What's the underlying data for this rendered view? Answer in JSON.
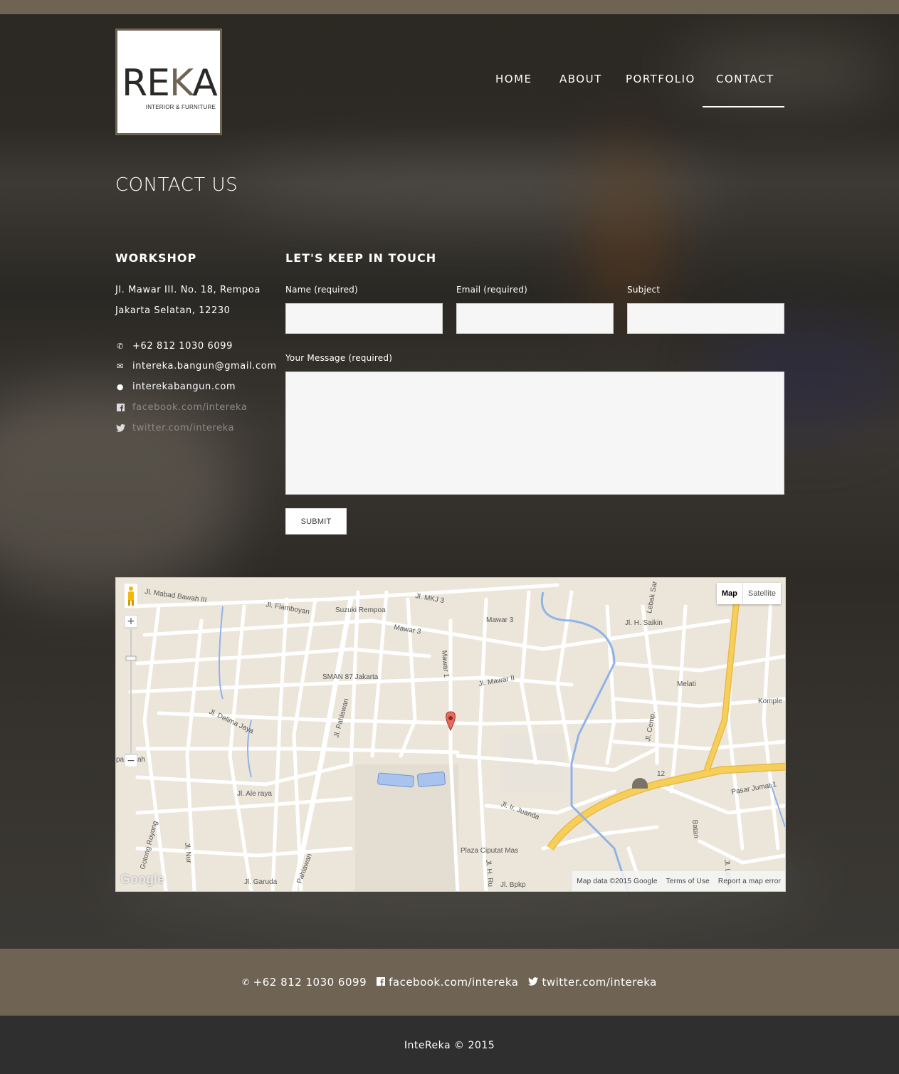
{
  "logo": {
    "word_a": "RE",
    "word_k": "K",
    "word_b": "A",
    "tagline": "INTERIOR & FURNITURE"
  },
  "nav": {
    "items": [
      {
        "label": "HOME"
      },
      {
        "label": "ABOUT"
      },
      {
        "label": "PORTFOLIO"
      },
      {
        "label": "CONTACT",
        "active": true
      }
    ]
  },
  "page_title": "CONTACT US",
  "workshop": {
    "title": "WORKSHOP",
    "address_line1": "Jl. Mawar III. No. 18, Rempoa",
    "address_line2": "Jakarta Selatan, 12230",
    "phone": "+62 812 1030 6099",
    "email": "intereka.bangun@gmail.com",
    "website": "interekabangun.com",
    "facebook": "facebook.com/intereka",
    "twitter": "twitter.com/intereka",
    "icons": {
      "phone": "phone-icon",
      "email": "envelope-icon",
      "website": "globe-icon",
      "facebook": "facebook-icon",
      "twitter": "twitter-icon"
    }
  },
  "form": {
    "title": "LET'S KEEP IN TOUCH",
    "name_label": "Name (required)",
    "email_label": "Email (required)",
    "subject_label": "Subject",
    "message_label": "Your Message (required)",
    "name_value": "",
    "email_value": "",
    "subject_value": "",
    "message_value": "",
    "submit_label": "SUBMIT"
  },
  "map": {
    "type_map": "Map",
    "type_satellite": "Satellite",
    "zoom_in": "+",
    "zoom_out": "−",
    "attribution": "Map data ©2015 Google",
    "terms": "Terms of Use",
    "report": "Report a map error",
    "google_logo": "Google",
    "labels": [
      "Jl. Mabad Bawah III",
      "Jl. Flamboyan",
      "Suzuki Rempoa",
      "Jl. MKJ 3",
      "Mawar 3",
      "Mawar 3",
      "Jl. H. Saikin",
      "Lebak Sar",
      "SMAN 87 Jakarta",
      "Mawar 1",
      "Jl. Mawar II",
      "Melati",
      "Jl. Delima Jaya",
      "Jl. Pahlawan",
      "Jl. Cemp.",
      "Jl. Ale raya",
      "Jl. Ir. Juanda",
      "Pasar Jumat 1",
      "Batan",
      "Plaza Ciputat Mas",
      "Gotong Royong",
      "Jl. Nur",
      "Jl. Garuda",
      "Pahlawan",
      "Jl. H. Ru",
      "Jl. Bpkp",
      "Jl. Lebak",
      "Komple",
      "12",
      "pa",
      "ah"
    ]
  },
  "footer": {
    "phone": "+62 812 1030 6099",
    "facebook": "facebook.com/intereka",
    "twitter": "twitter.com/intereka",
    "copyright": "InteReka © 2015"
  },
  "colors": {
    "accent": "#6f6354",
    "footer_dark": "#2f2f2f",
    "road_major": "#f6cf5b",
    "water": "#8fb3e8",
    "map_bg": "#ece6da"
  }
}
